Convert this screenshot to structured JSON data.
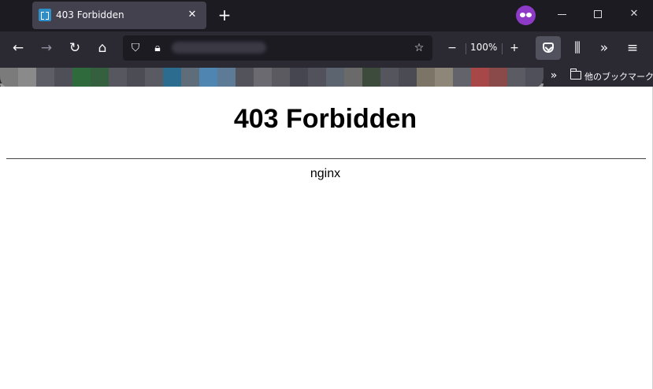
{
  "window": {
    "tab_title": "403 Forbidden",
    "tab_close_glyph": "✕",
    "new_tab_glyph": "+",
    "private_browsing_icon": "private-mask-icon",
    "minimize_icon": "minimize-icon",
    "maximize_icon": "maximize-icon",
    "close_glyph": "✕"
  },
  "toolbar": {
    "back_glyph": "←",
    "forward_glyph": "→",
    "reload_glyph": "↻",
    "home_glyph": "⌂",
    "shield_glyph": "⛉",
    "lock_glyph": "🔒︎",
    "star_glyph": "☆",
    "zoom_out_glyph": "−",
    "zoom_level": "100%",
    "zoom_in_glyph": "+",
    "library_glyph": "⫼",
    "overflow_glyph": "»",
    "menu_glyph": "≡"
  },
  "bookmarks": {
    "more_glyph": "»",
    "other_bookmarks_label": "他のブックマーク",
    "blurred_colors": [
      "#7b7b7b",
      "#8a8a8a",
      "#5e5e66",
      "#4f4f58",
      "#2f6a3d",
      "#35603f",
      "#575760",
      "#4c4c55",
      "#5a5a63",
      "#2b6c8f",
      "#5f6d7b",
      "#4e86b1",
      "#5d7a96",
      "#53535c",
      "#6a6a70",
      "#5a5a60",
      "#464650",
      "#52525c",
      "#5c6470",
      "#6a6a6a",
      "#3c4b3c",
      "#55555e",
      "#4b4b54",
      "#7d7468",
      "#8e8679",
      "#63636b",
      "#a84747",
      "#8b4a4a",
      "#5b5b64",
      "#50505a"
    ]
  },
  "page": {
    "heading": "403 Forbidden",
    "server": "nginx"
  }
}
